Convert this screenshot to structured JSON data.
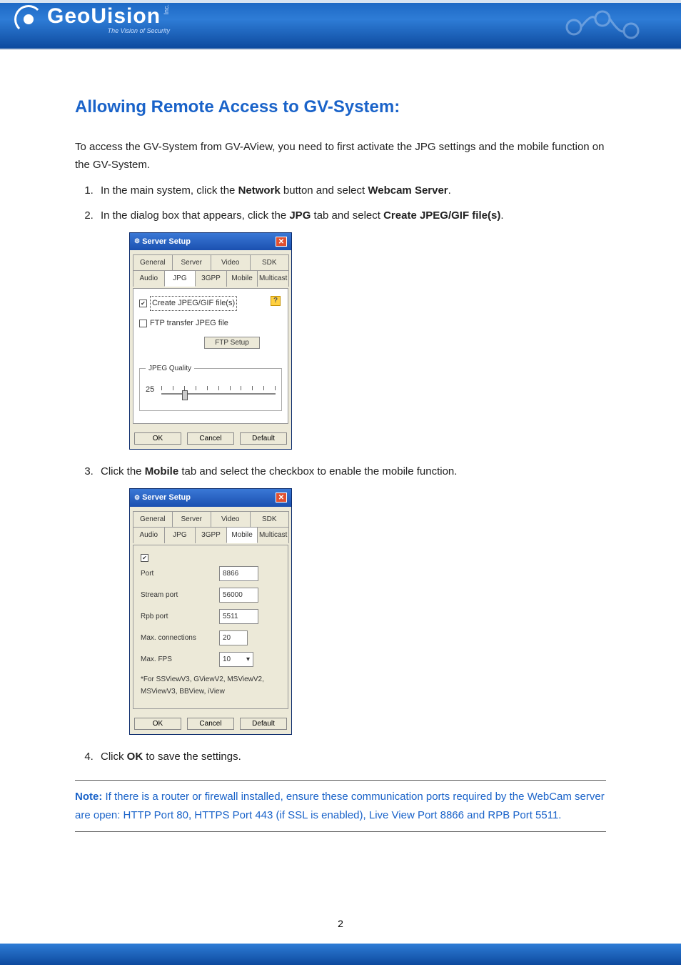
{
  "brand": {
    "name": "GeoUision",
    "suffix": "Inc.",
    "tagline": "The Vision of Security"
  },
  "title": "Allowing Remote Access to GV-System:",
  "intro": "To access the GV-System from GV-AView, you need to first activate the JPG settings and the mobile function on the GV-System.",
  "steps": {
    "s1_a": "In the main system, click the ",
    "s1_b1": "Network",
    "s1_c": " button and select ",
    "s1_b2": "Webcam Server",
    "s1_d": ".",
    "s2_a": "In the dialog box that appears, click the ",
    "s2_b1": "JPG",
    "s2_c": " tab and select ",
    "s2_b2": "Create JPEG/GIF file(s)",
    "s2_d": ".",
    "s3_a": "Click the ",
    "s3_b1": "Mobile",
    "s3_c": " tab and select the checkbox to enable the mobile function.",
    "s4_a": "Click ",
    "s4_b1": "OK",
    "s4_c": " to save the settings."
  },
  "dialog1": {
    "title": "Server Setup",
    "tabs_row1": [
      "General",
      "Server",
      "Video",
      "SDK"
    ],
    "tabs_row2": [
      "Audio",
      "JPG",
      "3GPP",
      "Mobile",
      "Multicast"
    ],
    "active_tab": "JPG",
    "opt1": "Create JPEG/GIF file(s)",
    "opt1_checked": true,
    "opt2": "FTP transfer JPEG file",
    "opt2_checked": false,
    "ftp_btn": "FTP Setup",
    "quality_legend": "JPEG Quality",
    "quality_value": "25",
    "buttons": [
      "OK",
      "Cancel",
      "Default"
    ]
  },
  "dialog2": {
    "title": "Server Setup",
    "tabs_row1": [
      "General",
      "Server",
      "Video",
      "SDK"
    ],
    "tabs_row2": [
      "Audio",
      "JPG",
      "3GPP",
      "Mobile",
      "Multicast"
    ],
    "active_tab": "Mobile",
    "top_checked": true,
    "fields": {
      "port": {
        "label": "Port",
        "value": "8866"
      },
      "stream": {
        "label": "Stream port",
        "value": "56000"
      },
      "rpb": {
        "label": "Rpb port",
        "value": "5511"
      },
      "maxconn": {
        "label": "Max. connections",
        "value": "20"
      },
      "maxfps": {
        "label": "Max. FPS",
        "value": "10"
      }
    },
    "note": "*For SSViewV3, GViewV2, MSViewV2, MSViewV3, BBView, iView",
    "buttons": [
      "OK",
      "Cancel",
      "Default"
    ]
  },
  "note": {
    "label": "Note:",
    "text": " If there is a router or firewall installed, ensure these communication ports required by the WebCam server are open: HTTP Port 80, HTTPS Port 443 (if SSL is enabled), Live View Port 8866 and RPB Port 5511."
  },
  "page_number": "2"
}
